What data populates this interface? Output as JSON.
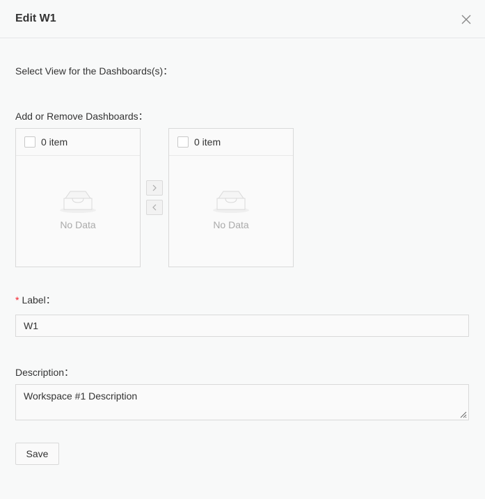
{
  "dialog": {
    "title": "Edit W1",
    "close_icon": "close-icon"
  },
  "form": {
    "view_label": "Select View for the Dashboards(s)：",
    "dashboards_label": "Add or Remove Dashboards：",
    "transfer": {
      "source": {
        "count_label": "0 item",
        "empty_text": "No Data"
      },
      "target": {
        "count_label": "0 item",
        "empty_text": "No Data"
      },
      "move_right_icon": "chevron-right-icon",
      "move_left_icon": "chevron-left-icon",
      "empty_icon": "empty-inbox-icon"
    },
    "label_field": {
      "required_mark": "*",
      "label": "Label：",
      "value": "W1"
    },
    "description_field": {
      "label": "Description：",
      "value": "Workspace #1 Description"
    },
    "save_label": "Save"
  }
}
